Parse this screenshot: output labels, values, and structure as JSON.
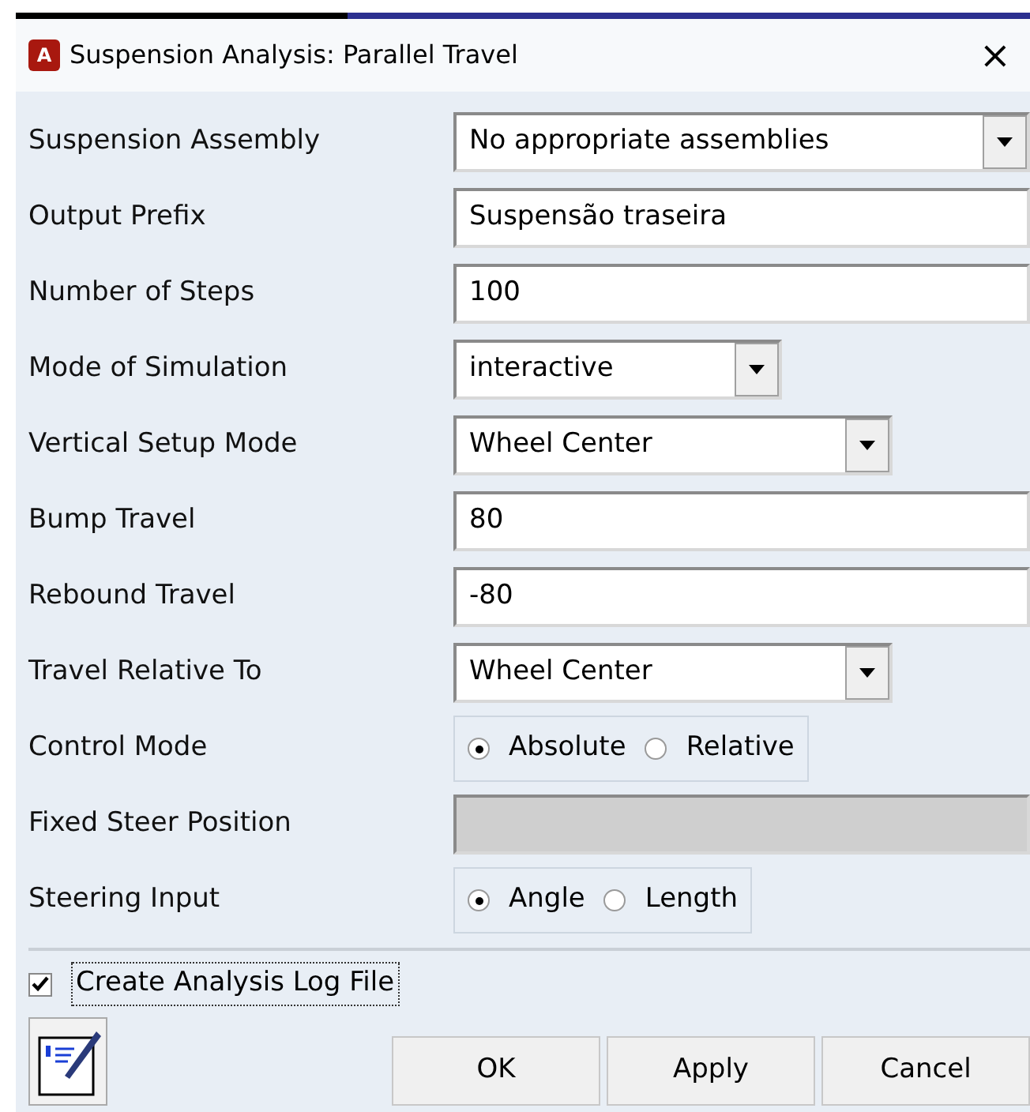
{
  "window": {
    "title": "Suspension Analysis: Parallel Travel",
    "app_icon_letter": "A",
    "close": "×"
  },
  "fields": [
    {
      "label": "Suspension Assembly",
      "kind": "dropdown",
      "value": "No appropriate assemblies"
    },
    {
      "label": "Output Prefix",
      "kind": "text",
      "value": "Suspensão traseira",
      "disabled": false
    },
    {
      "label": "Number of Steps",
      "kind": "text",
      "value": "100",
      "disabled": false
    },
    {
      "label": "Mode of Simulation",
      "kind": "dropdown",
      "value": "interactive"
    },
    {
      "label": "Vertical Setup Mode",
      "kind": "dropdown",
      "value": "Wheel Center"
    },
    {
      "label": "Bump Travel",
      "kind": "text",
      "value": "80",
      "disabled": false
    },
    {
      "label": "Rebound Travel",
      "kind": "text",
      "value": "-80",
      "disabled": false
    },
    {
      "label": "Travel Relative To",
      "kind": "dropdown",
      "value": "Wheel Center"
    },
    {
      "label": "Control Mode",
      "kind": "radio",
      "options": [
        {
          "label": "Absolute",
          "selected": true
        },
        {
          "label": "Relative",
          "selected": false
        }
      ]
    },
    {
      "label": "Fixed Steer Position",
      "kind": "text",
      "disabled": true
    },
    {
      "label": "Steering Input",
      "kind": "radio",
      "options": [
        {
          "label": "Angle",
          "selected": true
        },
        {
          "label": "Length",
          "selected": false
        }
      ]
    }
  ],
  "log_file": {
    "label": "Create Analysis Log File",
    "checked": true
  },
  "buttons": [
    "OK",
    "Apply",
    "Cancel"
  ]
}
